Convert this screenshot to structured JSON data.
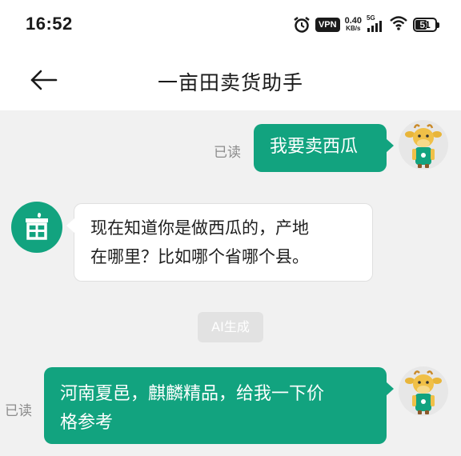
{
  "status_bar": {
    "time": "16:52",
    "vpn": "VPN",
    "net_speed_value": "0.40",
    "net_speed_unit": "KB/s",
    "network_type": "5G",
    "battery": "51"
  },
  "header": {
    "title": "一亩田卖货助手"
  },
  "messages": [
    {
      "from": "user",
      "text": "我要卖西瓜",
      "status": "已读"
    },
    {
      "from": "bot",
      "text_line1": "现在知道你是做西瓜的，产地",
      "text_line2": "在哪里？比如哪个省哪个县。"
    },
    {
      "tag": "AI生成"
    },
    {
      "from": "user",
      "text_line1": "河南夏邑，麒麟精品，给我一下价",
      "text_line2": "格参考",
      "status": "已读"
    }
  ],
  "colors": {
    "accent": "#12a37f",
    "background": "#f1f1f1",
    "read_status": "#8c8c8c"
  },
  "icons": {
    "back": "arrow-left-icon",
    "alarm": "alarm-clock-icon",
    "wifi": "wifi-icon",
    "signal": "cell-signal-icon",
    "bot_avatar": "storefront-icon",
    "user_avatar": "cow-mascot-icon"
  }
}
